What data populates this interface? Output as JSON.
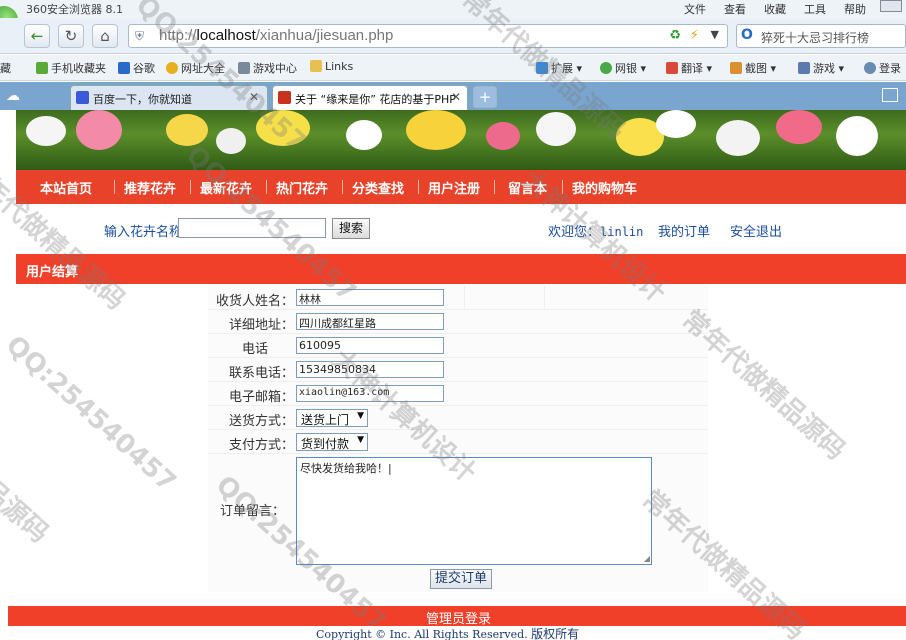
{
  "browser": {
    "app_title": "360安全浏览器 8.1",
    "menu": [
      "文件",
      "查看",
      "收藏",
      "工具",
      "帮助"
    ],
    "address": {
      "prefix": "http://",
      "host": "localhost",
      "path": "/xianhua/jiesuan.php"
    },
    "search_text": "猝死十大忌习排行榜",
    "favorites": [
      {
        "label": "藏",
        "color": "#e0e6ee"
      },
      {
        "label": "手机收藏夹",
        "color": "#5aaa3a"
      },
      {
        "label": "谷歌",
        "color": "#2a6ac8"
      },
      {
        "label": "网址大全",
        "color": "#e8b020"
      },
      {
        "label": "游戏中心",
        "color": "#7a8a9a"
      },
      {
        "label": "Links",
        "color": "#e8c050"
      },
      {
        "label": "扩展",
        "color": "#3a8ad8"
      },
      {
        "label": "网银",
        "color": "#4aa84a"
      },
      {
        "label": "翻译",
        "color": "#d84a3a"
      },
      {
        "label": "截图",
        "color": "#d89030"
      },
      {
        "label": "游戏",
        "color": "#5a7ab0"
      },
      {
        "label": "登录",
        "color": "#6a8ab0"
      }
    ],
    "tabs": [
      {
        "title": "百度一下，你就知道",
        "icon_color": "#3a5ad8"
      },
      {
        "title": "关于 “缘来是你” 花店的基于PHP",
        "icon_color": "#c8321e"
      }
    ]
  },
  "site": {
    "nav": [
      "本站首页",
      "推荐花卉",
      "最新花卉",
      "热门花卉",
      "分类查找",
      "用户注册",
      "留言本",
      "我的购物车"
    ],
    "search_label": "输入花卉名称",
    "search_button": "搜索",
    "welcome_prefix": "欢迎您：",
    "username": "linlin",
    "my_orders": "我的订单",
    "logout": "安全退出",
    "section_title": "用户结算"
  },
  "form": {
    "name_label": "收货人姓名：",
    "name_value": "林林",
    "address_label": "详细地址：",
    "address_value": "四川成都红星路",
    "zip_label": "电话",
    "zip_value": "610095",
    "phone_label": "联系电话：",
    "phone_value": "15349850834",
    "email_label": "电子邮箱：",
    "email_value": "xiaolin@163.com",
    "shipping_label": "送货方式：",
    "shipping_value": "送货上门",
    "payment_label": "支付方式：",
    "payment_value": "货到付款",
    "message_label": "订单留言：",
    "message_value": "尽快发货给我哈！|",
    "submit_label": "提交订单"
  },
  "footer": {
    "admin_login": "管理员登录",
    "copyright": "Copyright © Inc. All Rights Reserved.",
    "rights": "版权所有"
  },
  "watermarks": [
    "QQ:254540457",
    "大神计算机设计",
    "常年代做精品源码",
    "品源码"
  ]
}
